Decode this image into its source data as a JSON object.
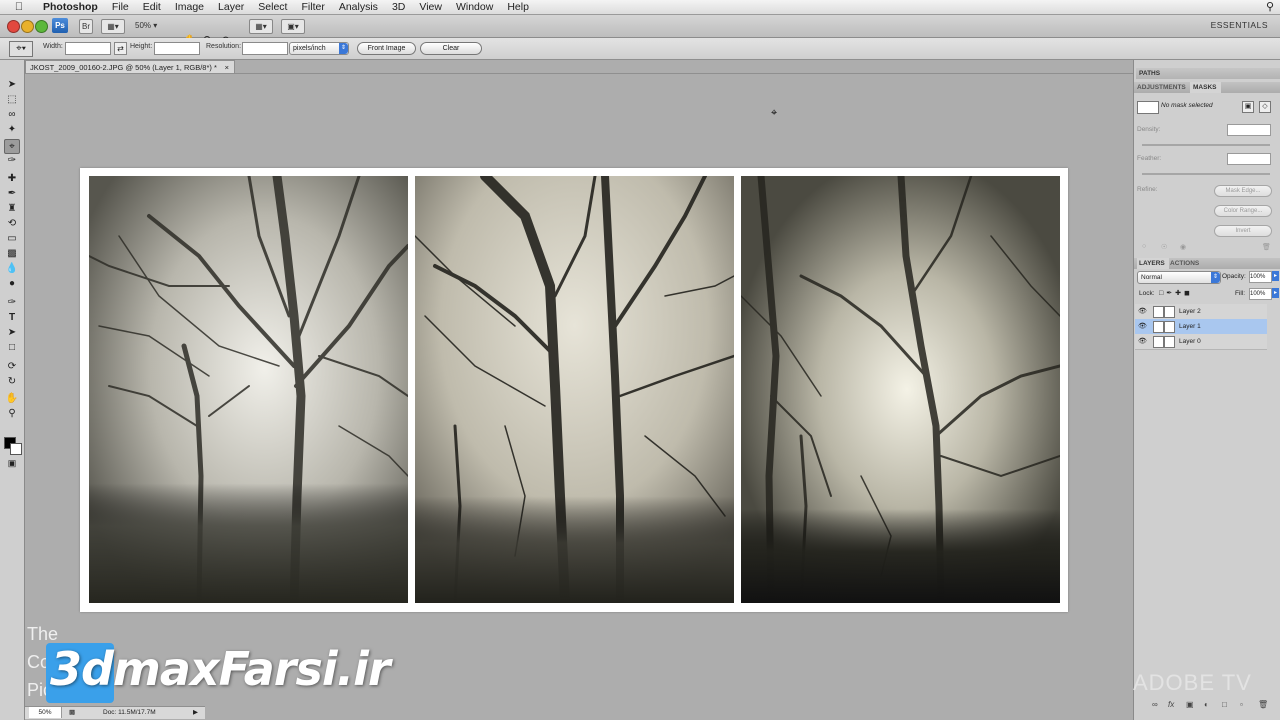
{
  "menubar": {
    "app_name": "Photoshop",
    "items": [
      "File",
      "Edit",
      "Image",
      "Layer",
      "Select",
      "Filter",
      "Analysis",
      "3D",
      "View",
      "Window",
      "Help"
    ]
  },
  "appbar": {
    "ps_badge": "Ps",
    "bridge": "Br",
    "zoom": "50%",
    "workspace": "ESSENTIALS"
  },
  "options": {
    "width_label": "Width:",
    "height_label": "Height:",
    "resolution_label": "Resolution:",
    "resolution_unit": "pixels/inch",
    "front_image": "Front Image",
    "clear": "Clear"
  },
  "document": {
    "tab_title": "JKOST_2009_00160-2.JPG @ 50% (Layer 1, RGB/8*) *",
    "close": "×"
  },
  "statusbar": {
    "zoom": "50%",
    "doc_info": "Doc: 11.5M/17.7M"
  },
  "panels": {
    "paths_tab": "PATHS",
    "adjustments_tab": "ADJUSTMENTS",
    "masks_tab": "MASKS",
    "mask_status": "No mask selected",
    "density_label": "Density:",
    "feather_label": "Feather:",
    "refine_label": "Refine:",
    "mask_edge": "Mask Edge...",
    "color_range": "Color Range...",
    "invert": "Invert",
    "layers_tab": "LAYERS",
    "actions_tab": "ACTIONS",
    "blend_mode": "Normal",
    "opacity_label": "Opacity:",
    "opacity_value": "100%",
    "lock_label": "Lock:",
    "fill_label": "Fill:",
    "fill_value": "100%",
    "layers": [
      {
        "name": "Layer 2",
        "selected": false
      },
      {
        "name": "Layer 1",
        "selected": true
      },
      {
        "name": "Layer 0",
        "selected": false
      }
    ]
  },
  "overlays": {
    "watermark": "3dmaxFarsi.ir",
    "left_text_1": "The",
    "left_text_2": "Co",
    "left_text_3": "Pic",
    "adobe_tv": "ADOBE TV"
  },
  "colors": {
    "accent": "#3b78d8",
    "selection": "#a9c7ef",
    "workspace_bg": "#adadad"
  }
}
